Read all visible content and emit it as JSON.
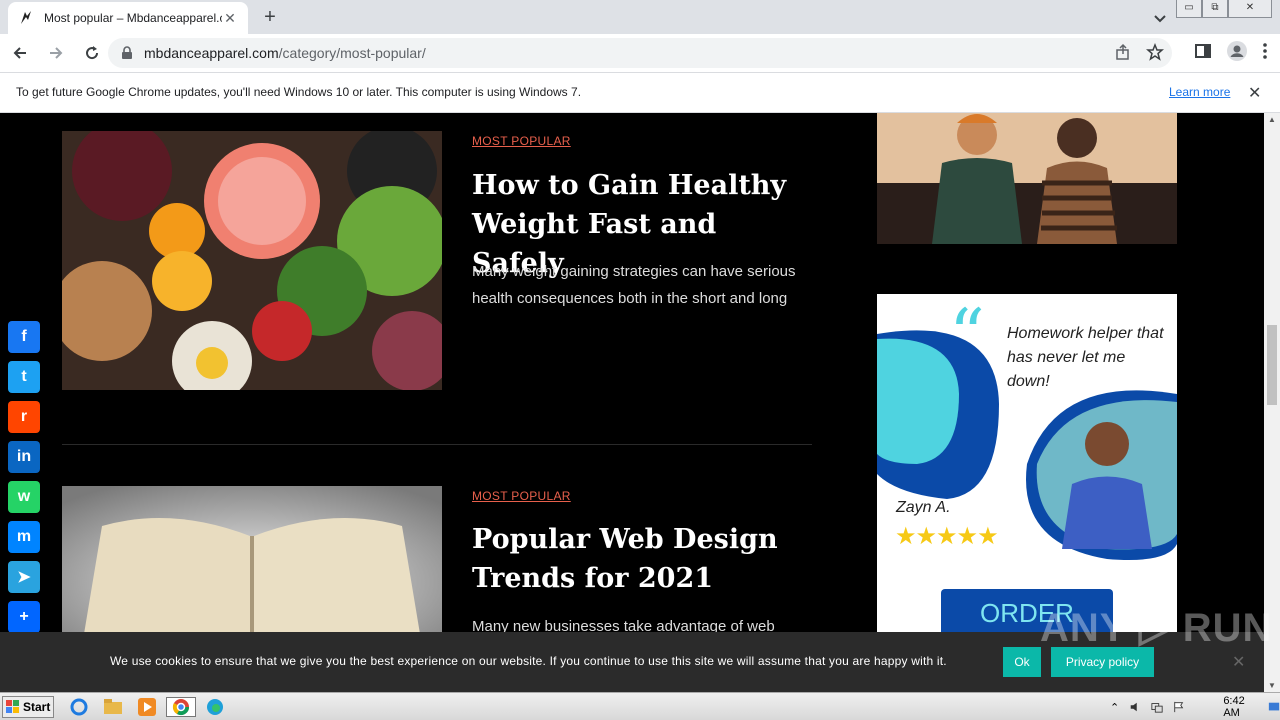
{
  "browser": {
    "tab_title": "Most popular – Mbdanceapparel.com",
    "tab_close": "✕",
    "new_tab": "+",
    "url_host": "mbdanceapparel.com",
    "url_path": "/category/most-popular/",
    "win_minimize": "▭",
    "win_restore": "⧉",
    "win_close": "✕"
  },
  "infobar": {
    "message": "To get future Google Chrome updates, you'll need Windows 10 or later. This computer is using Windows 7.",
    "learn_more": "Learn more",
    "close": "✕"
  },
  "posts": [
    {
      "category": "MOST POPULAR",
      "title": "How to Gain Healthy Weight Fast and Safely",
      "excerpt": "Many weight gaining strategies can have serious health consequences both in the short and long"
    },
    {
      "category": "MOST POPULAR",
      "title": "Popular Web Design Trends for 2021",
      "excerpt": "Many new businesses take advantage of web"
    }
  ],
  "ad": {
    "quote_mark": "“",
    "headline": "Homework helper that has never let me down!",
    "name": "Zayn A.",
    "stars": "★★★★★",
    "order_label": "ORDER"
  },
  "share": [
    {
      "name": "facebook",
      "glyph": "f",
      "color": "#1877f2"
    },
    {
      "name": "twitter",
      "glyph": "t",
      "color": "#1da1f2"
    },
    {
      "name": "reddit",
      "glyph": "r",
      "color": "#ff4500"
    },
    {
      "name": "linkedin",
      "glyph": "in",
      "color": "#0a66c2"
    },
    {
      "name": "whatsapp",
      "glyph": "w",
      "color": "#25d366"
    },
    {
      "name": "messenger",
      "glyph": "m",
      "color": "#0084ff"
    },
    {
      "name": "telegram",
      "glyph": "➤",
      "color": "#2aa3df"
    },
    {
      "name": "share",
      "glyph": "+",
      "color": "#0166ff"
    }
  ],
  "cookie": {
    "message": "We use cookies to ensure that we give you the best experience on our website. If you continue to use this site we will assume that you are happy with it.",
    "ok_label": "Ok",
    "privacy_label": "Privacy policy",
    "close": "✕"
  },
  "watermark": "ANY ▷ RUN",
  "taskbar": {
    "start_label": "Start",
    "clock": "6:42 AM"
  }
}
